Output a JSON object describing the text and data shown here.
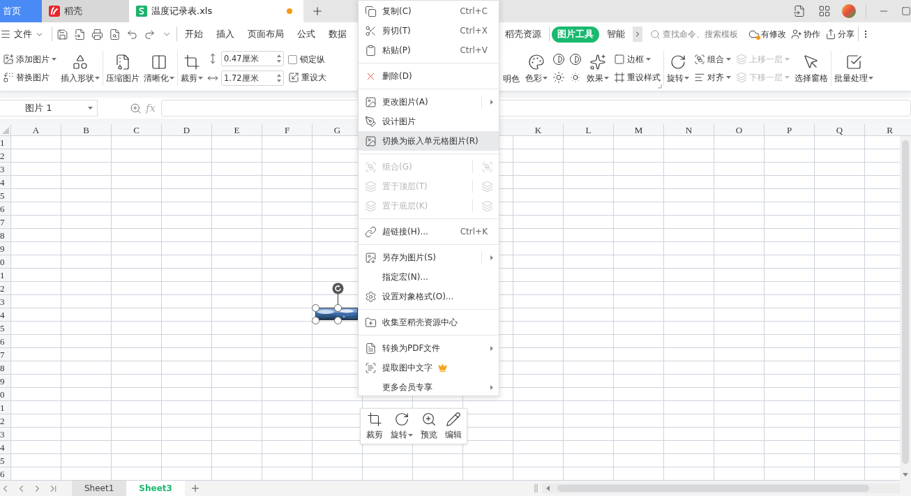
{
  "tabs": [
    {
      "label": "首页",
      "kind": "home",
      "selected": false,
      "unsaved": false
    },
    {
      "label": "稻壳",
      "kind": "docer",
      "selected": false,
      "unsaved": false
    },
    {
      "label": "温度记录表.xls",
      "kind": "sheet",
      "selected": true,
      "unsaved": true
    }
  ],
  "menu_bar": {
    "file": "文件",
    "tabs_left": [
      {
        "label": "开始",
        "selected": false
      },
      {
        "label": "插入",
        "selected": false
      },
      {
        "label": "页面布局",
        "selected": false
      },
      {
        "label": "公式",
        "selected": false
      },
      {
        "label": "数据",
        "selected": false
      }
    ],
    "tabs_right": [
      {
        "label": "稻壳资源",
        "selected": false
      },
      {
        "label": "图片工具",
        "selected": true
      },
      {
        "label": "智能",
        "selected": false
      }
    ],
    "search": {
      "placeholder": "查找命令、搜索模板"
    },
    "actions": [
      "有修改",
      "协作",
      "分享"
    ]
  },
  "ribbon": {
    "left": [
      [
        {
          "kind": "stack",
          "items": [
            {
              "kind": "button",
              "label": "添加图片",
              "dropdown": true,
              "disabled": false
            },
            {
              "kind": "button",
              "label": "替换图片",
              "dropdown": false,
              "disabled": false
            }
          ]
        },
        {
          "kind": "big",
          "label": "插入形状",
          "dropdown": true,
          "disabled": false
        }
      ],
      [
        {
          "kind": "big",
          "label": "压缩图片",
          "dropdown": false,
          "disabled": false
        },
        {
          "kind": "big",
          "label": "清晰化",
          "dropdown": true,
          "disabled": false
        }
      ],
      [
        {
          "kind": "big",
          "label": "裁剪",
          "dropdown": true,
          "disabled": false
        },
        {
          "kind": "stack",
          "items": [
            {
              "kind": "field",
              "value": "0.47厘米"
            },
            {
              "kind": "field",
              "value": "1.72厘米"
            }
          ]
        },
        {
          "kind": "stack",
          "items": [
            {
              "kind": "checkbox",
              "label": "锁定纵",
              "checked": false
            },
            {
              "kind": "button",
              "label": "重设大",
              "dropdown": false,
              "disabled": false
            }
          ]
        }
      ]
    ],
    "right": [
      [
        {
          "kind": "big",
          "label": "明色",
          "dropdown": false,
          "disabled": false
        },
        {
          "kind": "big",
          "label": "色彩",
          "dropdown": true,
          "disabled": false
        },
        {
          "kind": "adjust"
        },
        {
          "kind": "big",
          "label": "效果",
          "dropdown": true,
          "disabled": false
        },
        {
          "kind": "stack",
          "items": [
            {
              "kind": "button",
              "label": "边框",
              "dropdown": true,
              "disabled": false
            },
            {
              "kind": "button",
              "label": "重设样式",
              "dropdown": false,
              "disabled": false
            }
          ]
        }
      ],
      [
        {
          "kind": "big",
          "label": "旋转",
          "dropdown": true,
          "disabled": false
        },
        {
          "kind": "stack",
          "items": [
            {
              "kind": "button",
              "label": "组合",
              "dropdown": true,
              "disabled": false
            },
            {
              "kind": "button",
              "label": "对齐",
              "dropdown": true,
              "disabled": false
            }
          ]
        },
        {
          "kind": "stack",
          "items": [
            {
              "kind": "button",
              "label": "上移一层",
              "dropdown": true,
              "disabled": true
            },
            {
              "kind": "button",
              "label": "下移一层",
              "dropdown": true,
              "disabled": true
            }
          ]
        },
        {
          "kind": "big",
          "label": "选择窗格",
          "dropdown": false,
          "disabled": false
        }
      ],
      [
        {
          "kind": "big",
          "label": "批量处理",
          "dropdown": true,
          "disabled": false
        }
      ]
    ]
  },
  "formula_bar": {
    "name_box": "图片 1",
    "fx": "fx"
  },
  "columns_left": [
    "A",
    "B",
    "C",
    "D",
    "E",
    "F",
    "G"
  ],
  "columns_right": [
    "K",
    "L",
    "M",
    "N",
    "O",
    "P",
    "Q",
    "R"
  ],
  "rows": [
    "1",
    "2",
    "3",
    "4",
    "5",
    "6",
    "7",
    "8",
    "9",
    "0",
    "1",
    "2",
    "3",
    "4",
    "5",
    "6",
    "7",
    "8",
    "9",
    "0",
    "1",
    "2",
    "3",
    "4",
    "5",
    "6"
  ],
  "picture": {
    "kind": "picture",
    "selected": true
  },
  "context_menu": {
    "groups": [
      [
        {
          "label": "复制(C)",
          "shortcut": "Ctrl+C",
          "disabled": false,
          "highlighted": false,
          "submenu": false,
          "split": false,
          "premium": false
        },
        {
          "label": "剪切(T)",
          "shortcut": "Ctrl+X",
          "disabled": false,
          "highlighted": false,
          "submenu": false,
          "split": false,
          "premium": false
        },
        {
          "label": "粘贴(P)",
          "shortcut": "Ctrl+V",
          "disabled": false,
          "highlighted": false,
          "submenu": false,
          "split": false,
          "premium": false
        }
      ],
      [
        {
          "label": "删除(D)",
          "disabled": false,
          "highlighted": false,
          "submenu": false,
          "split": false,
          "premium": false
        }
      ],
      [
        {
          "label": "更改图片(A)",
          "disabled": false,
          "highlighted": false,
          "submenu": true,
          "split": true,
          "premium": false
        },
        {
          "label": "设计图片",
          "disabled": false,
          "highlighted": false,
          "submenu": false,
          "split": false,
          "premium": false
        },
        {
          "label": "切换为嵌入单元格图片(R)",
          "disabled": false,
          "highlighted": true,
          "submenu": false,
          "split": false,
          "premium": false
        }
      ],
      [
        {
          "label": "组合(G)",
          "disabled": true,
          "highlighted": false,
          "submenu": false,
          "split": true,
          "premium": false
        },
        {
          "label": "置于顶层(T)",
          "disabled": true,
          "highlighted": false,
          "submenu": false,
          "split": true,
          "premium": false
        },
        {
          "label": "置于底层(K)",
          "disabled": true,
          "highlighted": false,
          "submenu": false,
          "split": true,
          "premium": false
        }
      ],
      [
        {
          "label": "超链接(H)...",
          "shortcut": "Ctrl+K",
          "disabled": false,
          "highlighted": false,
          "submenu": false,
          "split": false,
          "premium": false
        }
      ],
      [
        {
          "label": "另存为图片(S)",
          "disabled": false,
          "highlighted": false,
          "submenu": true,
          "split": true,
          "premium": false
        },
        {
          "label": "指定宏(N)...",
          "disabled": false,
          "highlighted": false,
          "submenu": false,
          "split": false,
          "premium": false
        },
        {
          "label": "设置对象格式(O)...",
          "disabled": false,
          "highlighted": false,
          "submenu": false,
          "split": false,
          "premium": false
        }
      ],
      [
        {
          "label": "收集至稻壳资源中心",
          "disabled": false,
          "highlighted": false,
          "submenu": false,
          "split": false,
          "premium": false
        }
      ],
      [
        {
          "label": "转换为PDF文件",
          "disabled": false,
          "highlighted": false,
          "submenu": true,
          "split": false,
          "premium": false
        },
        {
          "label": "提取图中文字",
          "disabled": false,
          "highlighted": false,
          "submenu": false,
          "split": false,
          "premium": true
        },
        {
          "label": "更多会员专享",
          "disabled": false,
          "highlighted": false,
          "submenu": true,
          "split": false,
          "premium": false
        }
      ]
    ]
  },
  "mini_toolbar": [
    {
      "label": "裁剪",
      "dropdown": false
    },
    {
      "label": "旋转",
      "dropdown": true
    },
    {
      "label": "预览",
      "dropdown": false
    },
    {
      "label": "编辑",
      "dropdown": false
    }
  ],
  "sheet_tabs": [
    {
      "label": "Sheet1",
      "selected": false
    },
    {
      "label": "Sheet3",
      "selected": true
    }
  ]
}
